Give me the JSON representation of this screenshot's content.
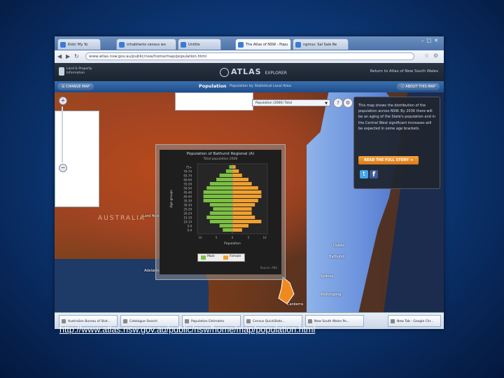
{
  "browser": {
    "tabs": [
      {
        "label": "Kids! My Yo"
      },
      {
        "label": "inhabitants census wo"
      },
      {
        "label": "Untitle"
      },
      {
        "label": "The Atlas of NSW - Popu"
      },
      {
        "label": "ngmus: Sal Sale Re"
      }
    ],
    "url": "www.atlas.nsw.gov.au/public/nsw/home/map/population.html"
  },
  "header": {
    "org": "Land & Property Information",
    "logo_main": "ATLAS",
    "logo_sub": "EXPLORER",
    "right_text": "Return to Atlas of New South Wales"
  },
  "toolbar": {
    "change_map": "CHANGE MAP",
    "title": "Population",
    "subtitle": "Population by Statistical Local Area",
    "about_map": "ABOUT THIS MAP"
  },
  "map": {
    "australia_label": "AUSTRALIA",
    "select_value": "Population (2006) Total",
    "labels": {
      "sydney": "Sydney",
      "wollongong": "Wollongong",
      "lord_howe": "Lord Howe",
      "adelaide": "Adelaide",
      "canberra": "Canberra",
      "bathurst": "Bathurst",
      "dubbo": "Dubbo"
    },
    "bing": "bing"
  },
  "info_panel": {
    "text": "This map shows the distribution of the population across NSW. By 2036 there will be an aging of the State's population and in the Central West significant increases will be expected in some age brackets.",
    "story_button": "READ THE FULL STORY",
    "colors": {
      "twitter": "#43a6e6",
      "facebook": "#3b5a9a"
    }
  },
  "chart_data": {
    "type": "bar",
    "title": "Population of Bathurst Regional (A)",
    "subtitle": "Total population 2006",
    "categories": [
      "75+",
      "70-74",
      "65-74",
      "60-64",
      "55-59",
      "50-54",
      "45-49",
      "40-44",
      "35-39",
      "30-34",
      "25-29",
      "20-24",
      "15-19",
      "10-14",
      "5-9",
      "0-4"
    ],
    "series": [
      {
        "name": "Male",
        "color": "#7bc043",
        "values": [
          1,
          2,
          4,
          5,
          7,
          8,
          9,
          9,
          9,
          7,
          6,
          7,
          8,
          7,
          4,
          3
        ]
      },
      {
        "name": "Female",
        "color": "#f0a030",
        "values": [
          1,
          2,
          3,
          5,
          6,
          8,
          9,
          9,
          8,
          7,
          6,
          6,
          7,
          9,
          5,
          3
        ]
      }
    ],
    "xlabel": "Population",
    "ylabel": "Age groups",
    "xlim": [
      -10,
      10
    ],
    "footnote": "Source: ABS"
  },
  "taskbar": {
    "items": [
      {
        "label": "Australian Bureau of Stat..."
      },
      {
        "label": "Catalogue Search"
      },
      {
        "label": "Population Estimates"
      },
      {
        "label": "Census QuickStats..."
      },
      {
        "label": "New South Wales Po..."
      },
      {
        "label": "New Tab - Google Chr..."
      }
    ]
  },
  "caption": "http://www.atlas.nsw.gov.au/public/nsw/home/map/population.html"
}
